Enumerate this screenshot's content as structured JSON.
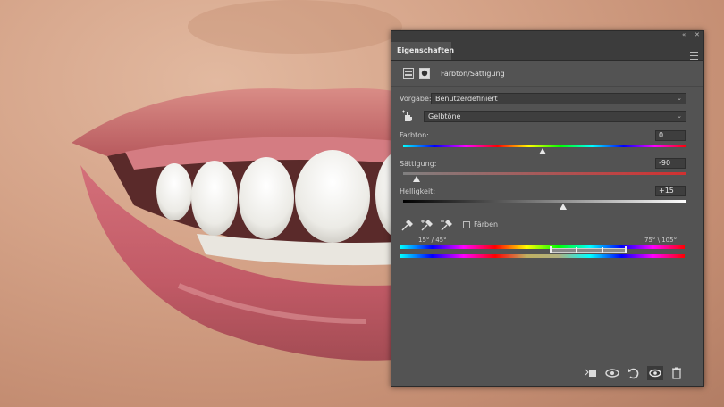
{
  "panel": {
    "tab_title": "Eigenschaften",
    "collapse_glyph": "«",
    "close_glyph": "✕",
    "adjustment_title": "Farbton/Sättigung",
    "preset_label": "Vorgabe:",
    "preset_value": "Benutzerdefiniert",
    "channel_value": "Gelbtöne",
    "hue_label": "Farbton:",
    "hue_value": "0",
    "saturation_label": "Sättigung:",
    "saturation_value": "-90",
    "lightness_label": "Helligkeit:",
    "lightness_value": "+15",
    "colorize_label": "Färben",
    "range_left": "15° / 45°",
    "range_right": "75° \\ 105°",
    "slider_levels": {
      "hue": 0,
      "saturation": -90,
      "lightness": 15
    },
    "icons": [
      "adjustment-layer-icon",
      "mask-icon",
      "targeted-adjust-hand-icon",
      "eyedropper-icon",
      "eyedropper-plus-icon",
      "eyedropper-minus-icon",
      "clip-to-layer-icon",
      "view-previous-state-icon",
      "reset-icon",
      "visibility-eye-icon",
      "trash-icon"
    ]
  },
  "colors": {
    "panel_bg": "#535353",
    "field_bg": "#3e3e3e",
    "lip": "#c86c6e"
  }
}
